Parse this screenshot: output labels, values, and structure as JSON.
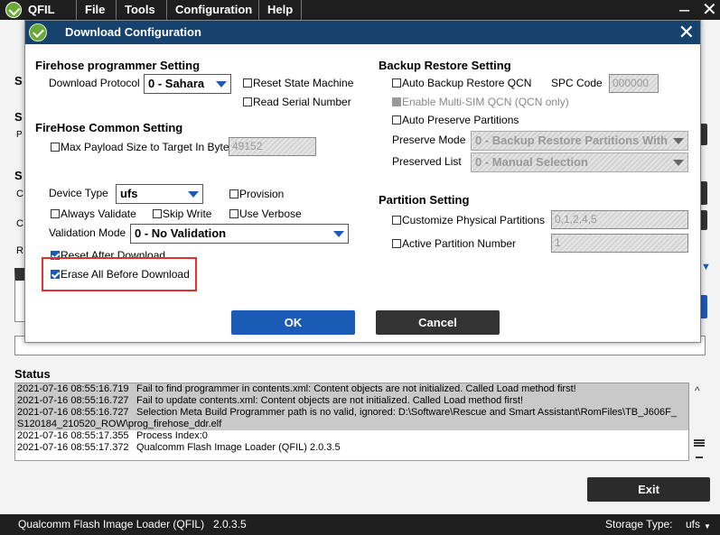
{
  "app": {
    "name": "QFIL",
    "menus": [
      "File",
      "Tools",
      "Configuration",
      "Help"
    ],
    "minimize": "–",
    "close": "✕"
  },
  "dialog": {
    "title": "Download Configuration",
    "close": "✕",
    "firehose_programmer": {
      "heading": "Firehose programmer Setting",
      "download_protocol_label": "Download Protocol",
      "download_protocol_value": "0 - Sahara",
      "reset_state_machine": "Reset State Machine",
      "read_serial_number": "Read Serial Number"
    },
    "firehose_common": {
      "heading": "FireHose Common Setting",
      "max_payload_label": "Max Payload Size to Target In Byte",
      "max_payload_value": "49152",
      "device_type_label": "Device Type",
      "device_type_value": "ufs",
      "provision": "Provision",
      "always_validate": "Always Validate",
      "skip_write": "Skip Write",
      "use_verbose": "Use Verbose",
      "validation_mode_label": "Validation Mode",
      "validation_mode_value": "0 - No Validation",
      "reset_after_download": "Reset After Download",
      "erase_all_before_download": "Erase All Before Download"
    },
    "backup_restore": {
      "heading": "Backup Restore Setting",
      "auto_backup_restore_qcn": "Auto Backup Restore QCN",
      "spc_code_label": "SPC Code",
      "spc_code_value": "000000",
      "enable_multi_sim_qcn": "Enable Multi-SIM QCN (QCN only)",
      "auto_preserve_partitions": "Auto Preserve Partitions",
      "preserve_mode_label": "Preserve Mode",
      "preserve_mode_value": "0 - Backup Restore Partitions With",
      "preserved_list_label": "Preserved List",
      "preserved_list_value": "0 - Manual Selection"
    },
    "partition": {
      "heading": "Partition Setting",
      "customize_physical_partitions": "Customize Physical Partitions",
      "physical_partitions_value": "0,1,2,4,5",
      "active_partition_number": "Active Partition Number",
      "active_partition_value": "1"
    },
    "ok": "OK",
    "cancel": "Cancel"
  },
  "main": {
    "status_title": "Status",
    "log": [
      {
        "time": "2021-07-16 08:55:16.719",
        "msg": "Fail to find programmer in contents.xml: Content objects are not initialized. Called Load method first!",
        "highlight": true
      },
      {
        "time": "2021-07-16 08:55:16.727",
        "msg": "Fail to update contents.xml: Content objects are not initialized. Called Load method first!",
        "highlight": true
      },
      {
        "time": "2021-07-16 08:55:16.727",
        "msg": "Selection Meta Build Programmer path is no valid, ignored: D:\\Software\\Rescue and Smart Assistant\\RomFiles\\TB_J606F_",
        "highlight": true
      },
      {
        "time": "",
        "msg": "S120184_210520_ROW\\prog_firehose_ddr.elf",
        "highlight": true
      },
      {
        "time": "2021-07-16 08:55:17.355",
        "msg": "Process Index:0",
        "highlight": false
      },
      {
        "time": "2021-07-16 08:55:17.372",
        "msg": "Qualcomm Flash Image Loader (QFIL) 2.0.3.5",
        "highlight": false
      }
    ],
    "exit": "Exit",
    "side_letters": [
      "S",
      "S",
      "P",
      "S",
      "C",
      "C",
      "R"
    ]
  },
  "statusbar": {
    "app_name": "Qualcomm Flash Image Loader (QFIL)",
    "version": "2.0.3.5",
    "storage_label": "Storage Type:",
    "storage_value": "ufs"
  },
  "colors": {
    "dialog_title_bg": "#17426e",
    "ok_button": "#1a5bb5",
    "highlight_box": "#e03030"
  }
}
